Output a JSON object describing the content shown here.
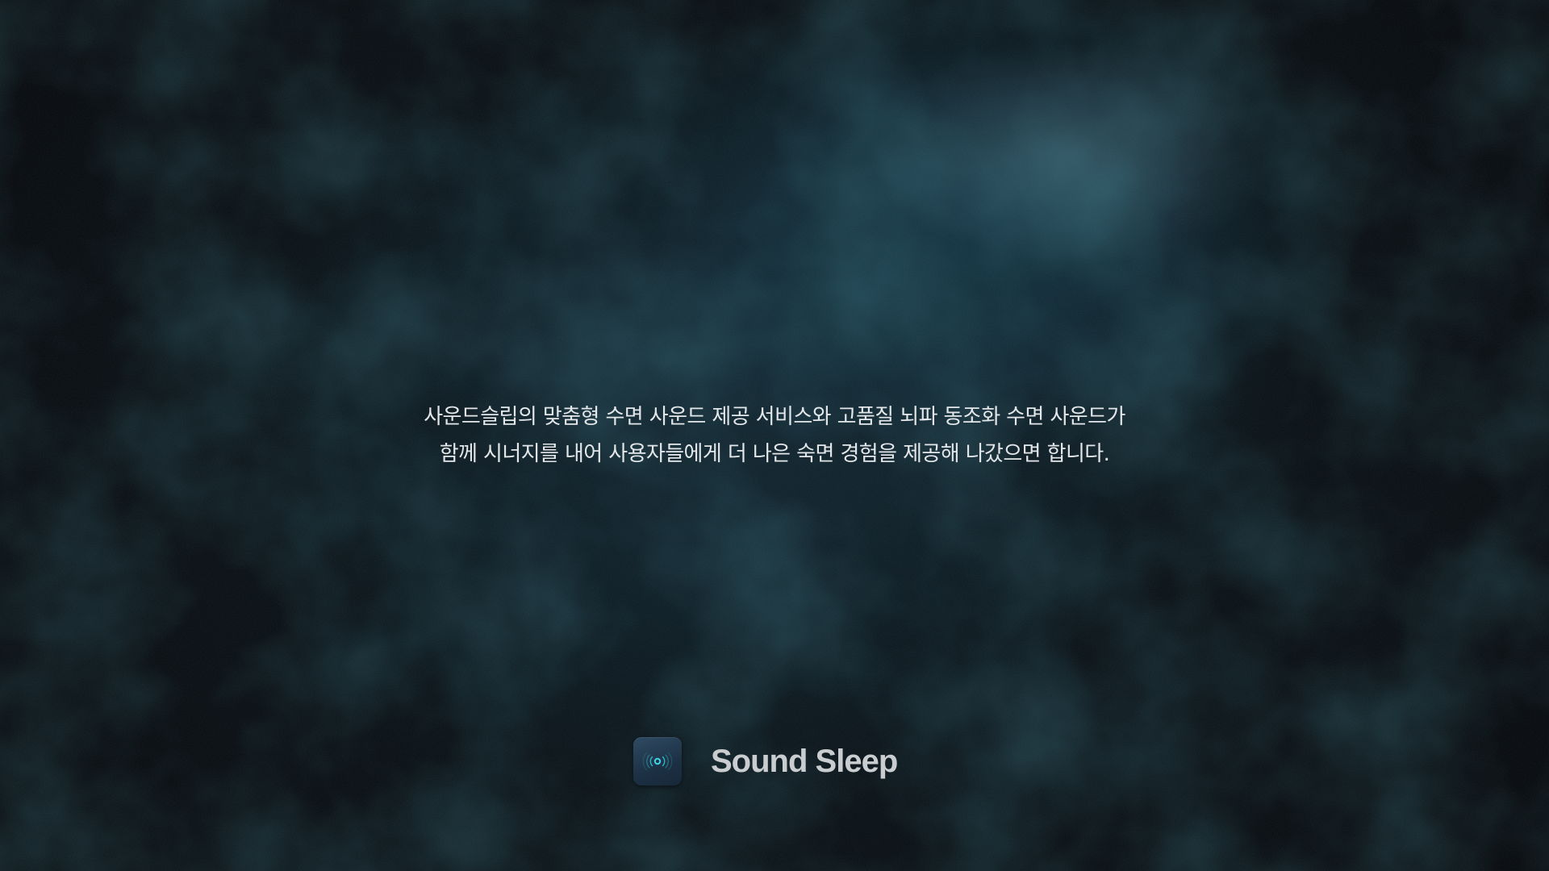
{
  "message": {
    "line1": "사운드슬립의 맞춤형 수면 사운드 제공 서비스와 고품질 뇌파 동조화 수면 사운드가",
    "line2": "함께 시너지를 내어 사용자들에게 더 나은 숙면 경험을 제공해 나갔으면 합니다."
  },
  "brand": {
    "name": "Sound Sleep",
    "icon": "sound-wave-icon"
  },
  "colors": {
    "background": "#05080b",
    "accent": "#2ec4d6",
    "text": "#e3e7ea",
    "brand_text": "#c9cdd0"
  }
}
